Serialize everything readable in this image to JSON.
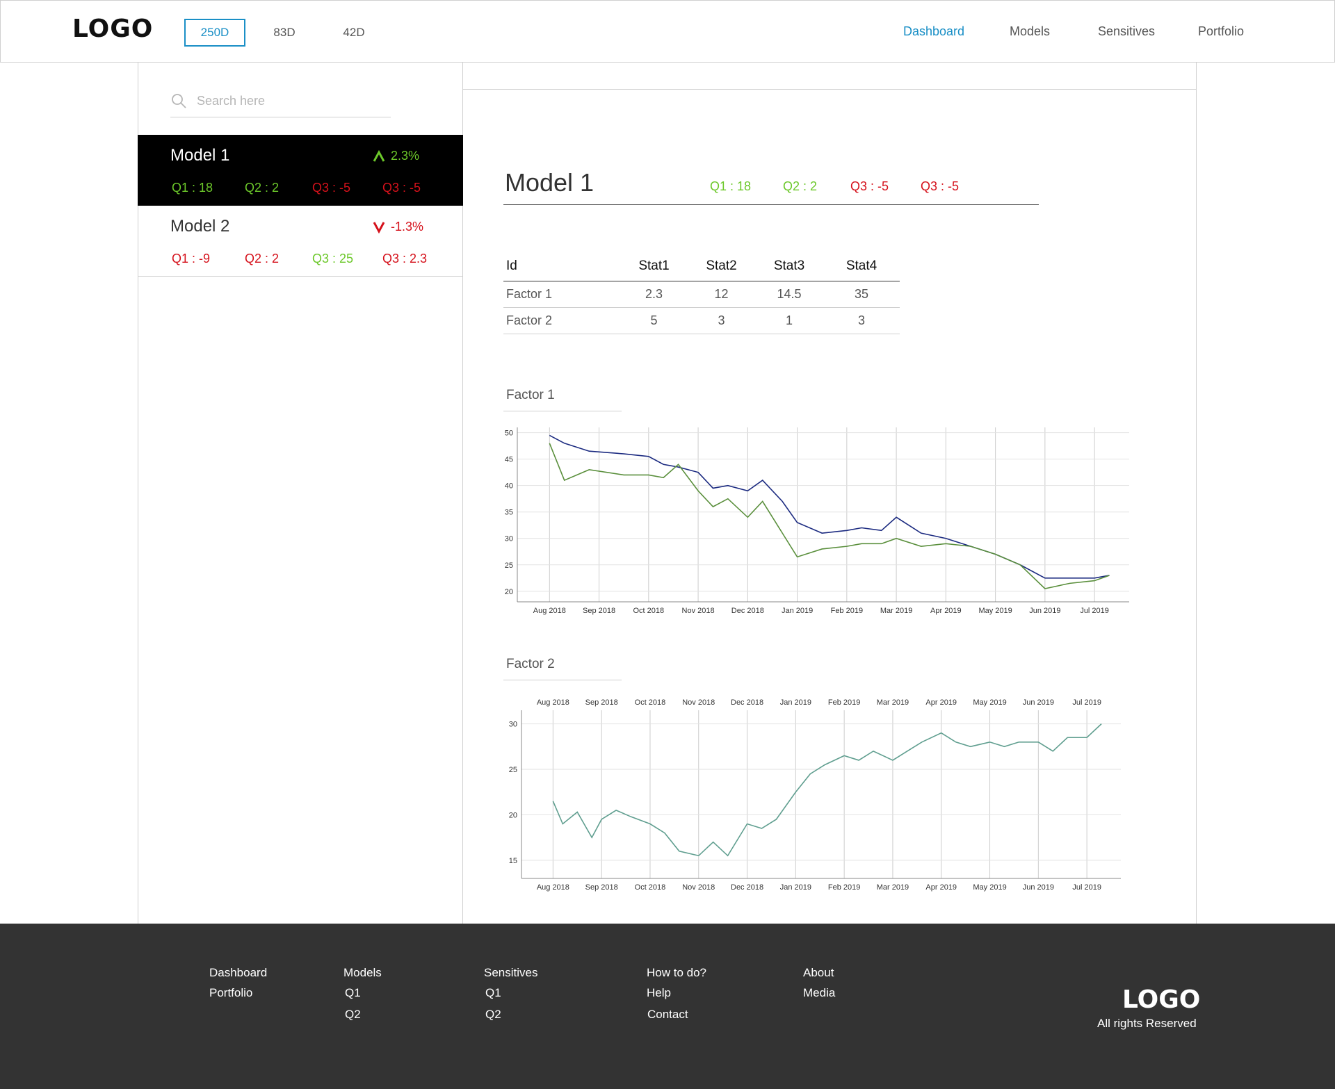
{
  "header": {
    "logo": "LOGO",
    "ranges": [
      "250D",
      "83D",
      "42D"
    ],
    "active_range": "250D",
    "nav": [
      "Dashboard",
      "Models",
      "Sensitives",
      "Portfolio"
    ],
    "active_nav": "Dashboard"
  },
  "colors": {
    "accent": "#1a8fc6",
    "positive": "#6cc82a",
    "negative": "#d5111b",
    "footer_bg": "#333333",
    "selected_card_bg": "#000000"
  },
  "search": {
    "placeholder": "Search here"
  },
  "models": [
    {
      "name": "Model 1",
      "change": "2.3%",
      "direction": "up",
      "quarters": [
        {
          "label": "Q1 : 18",
          "sentiment": "positive"
        },
        {
          "label": "Q2 : 2",
          "sentiment": "positive"
        },
        {
          "label": "Q3 : -5",
          "sentiment": "negative"
        },
        {
          "label": "Q3 : -5",
          "sentiment": "negative"
        }
      ]
    },
    {
      "name": "Model 2",
      "change": "-1.3%",
      "direction": "down",
      "quarters": [
        {
          "label": "Q1 : -9",
          "sentiment": "negative"
        },
        {
          "label": "Q2 : 2",
          "sentiment": "negative"
        },
        {
          "label": "Q3 : 25",
          "sentiment": "positive"
        },
        {
          "label": "Q3 : 2.3",
          "sentiment": "negative"
        }
      ]
    }
  ],
  "main": {
    "title": "Model 1",
    "quarters": [
      {
        "label": "Q1 : 18",
        "sentiment": "positive"
      },
      {
        "label": "Q2 : 2",
        "sentiment": "positive"
      },
      {
        "label": "Q3 : -5",
        "sentiment": "negative"
      },
      {
        "label": "Q3 : -5",
        "sentiment": "negative"
      }
    ],
    "table": {
      "headers": [
        "Id",
        "Stat1",
        "Stat2",
        "Stat3",
        "Stat4"
      ],
      "rows": [
        [
          "Factor 1",
          "2.3",
          "12",
          "14.5",
          "35"
        ],
        [
          "Factor 2",
          "5",
          "3",
          "1",
          "3"
        ]
      ]
    },
    "factor1_title": "Factor 1",
    "factor2_title": "Factor 2"
  },
  "chart_data": [
    {
      "type": "line",
      "months": [
        "Aug 2018",
        "Sep 2018",
        "Oct 2018",
        "Nov 2018",
        "Dec 2018",
        "Jan 2019",
        "Feb 2019",
        "Mar 2019",
        "Apr 2019",
        "May 2019",
        "Jun 2019",
        "Jul 2019"
      ],
      "y_ticks": [
        50,
        45,
        40,
        35,
        30,
        25,
        20
      ],
      "ylim": [
        18,
        51
      ],
      "grid": true,
      "series": [
        {
          "color": "#1b2a80",
          "x": [
            0,
            0.3,
            0.8,
            1.5,
            2,
            2.3,
            2.6,
            3,
            3.3,
            3.6,
            4.0,
            4.3,
            4.7,
            5.0,
            5.5,
            6,
            6.3,
            6.7,
            7,
            7.5,
            8,
            8.5,
            9,
            9.5,
            10,
            10.5,
            11,
            11.3
          ],
          "y": [
            49.5,
            48,
            46.5,
            46,
            45.5,
            44,
            43.5,
            42.5,
            39.5,
            40,
            39,
            41,
            37,
            33,
            31,
            31.5,
            32,
            31.5,
            34,
            31,
            30,
            28.5,
            27,
            25,
            22.5,
            22.5,
            22.5,
            23
          ]
        },
        {
          "color": "#5a8f3c",
          "x": [
            0,
            0.3,
            0.8,
            1.5,
            2,
            2.3,
            2.6,
            3,
            3.3,
            3.6,
            4.0,
            4.3,
            4.7,
            5.0,
            5.5,
            6,
            6.3,
            6.7,
            7,
            7.5,
            8,
            8.5,
            9,
            9.5,
            10,
            10.5,
            11,
            11.3
          ],
          "y": [
            48,
            41,
            43,
            42,
            42,
            41.5,
            44,
            39,
            36,
            37.5,
            34,
            37,
            31,
            26.5,
            28,
            28.5,
            29,
            29,
            30,
            28.5,
            29,
            28.5,
            27,
            25,
            20.5,
            21.5,
            22,
            23
          ]
        }
      ]
    },
    {
      "type": "line",
      "months": [
        "Aug 2018",
        "Sep 2018",
        "Oct 2018",
        "Nov 2018",
        "Dec 2018",
        "Jan 2019",
        "Feb 2019",
        "Mar 2019",
        "Apr 2019",
        "May 2019",
        "Jun 2019",
        "Jul 2019"
      ],
      "y_ticks": [
        30,
        25,
        20,
        15
      ],
      "ylim": [
        13,
        31.5
      ],
      "grid": true,
      "series": [
        {
          "color": "#5f9e8f",
          "x": [
            0,
            0.2,
            0.5,
            0.8,
            1.0,
            1.3,
            1.6,
            2.0,
            2.3,
            2.6,
            3.0,
            3.3,
            3.6,
            4.0,
            4.3,
            4.6,
            5.0,
            5.3,
            5.6,
            6.0,
            6.3,
            6.6,
            7.0,
            7.3,
            7.6,
            8.0,
            8.3,
            8.6,
            9.0,
            9.3,
            9.6,
            10.0,
            10.3,
            10.6,
            11.0,
            11.3
          ],
          "y": [
            21.5,
            19,
            20.3,
            17.5,
            19.5,
            20.5,
            19.8,
            19,
            18,
            16,
            15.5,
            17,
            15.5,
            19,
            18.5,
            19.5,
            22.5,
            24.5,
            25.5,
            26.5,
            26,
            27,
            26,
            27,
            28,
            29,
            28,
            27.5,
            28,
            27.5,
            28,
            28,
            27,
            28.5,
            28.5,
            30
          ]
        }
      ]
    }
  ],
  "footer": {
    "columns": [
      [
        "Dashboard",
        "Portfolio"
      ],
      [
        "Models",
        "Q1",
        "Q2"
      ],
      [
        "Sensitives",
        "Q1",
        "Q2"
      ],
      [
        "How to do?",
        "Help",
        "Contact"
      ],
      [
        "About",
        "Media"
      ]
    ],
    "logo": "LOGO",
    "rights": "All rights Reserved"
  }
}
